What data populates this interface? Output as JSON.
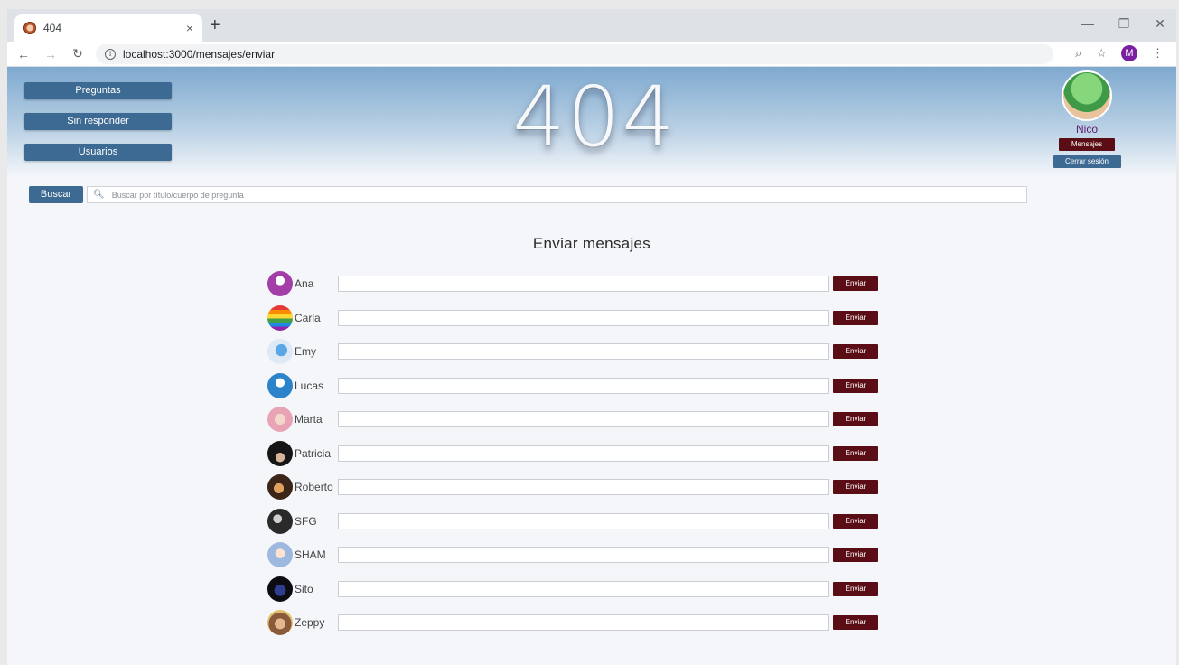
{
  "browser": {
    "tab_title": "404",
    "tab_close": "×",
    "new_tab": "+",
    "url": "localhost:3000/mensajes/enviar",
    "profile_initial": "M",
    "controls": {
      "minimize": "—",
      "restore": "❐",
      "close": "✕"
    }
  },
  "nav": {
    "preguntas": "Preguntas",
    "sin_responder": "Sin responder",
    "usuarios": "Usuarios"
  },
  "logo_text": "404",
  "user": {
    "name": "Nico",
    "mensajes_label": "Mensajes",
    "cerrar_label": "Cerrar sesión"
  },
  "search": {
    "button": "Buscar",
    "placeholder": "Buscar por título/cuerpo de pregunta"
  },
  "title": "Enviar mensajes",
  "send_label": "Enviar",
  "users": [
    {
      "name": "Ana"
    },
    {
      "name": "Carla"
    },
    {
      "name": "Emy"
    },
    {
      "name": "Lucas"
    },
    {
      "name": "Marta"
    },
    {
      "name": "Patricia"
    },
    {
      "name": "Roberto"
    },
    {
      "name": "SFG"
    },
    {
      "name": "SHAM"
    },
    {
      "name": "Sito"
    },
    {
      "name": "Zeppy"
    }
  ],
  "colors": {
    "nav_blue": "#3d6a92",
    "send_maroon": "#5a0d14",
    "user_name_purple": "#5d1b6e"
  }
}
